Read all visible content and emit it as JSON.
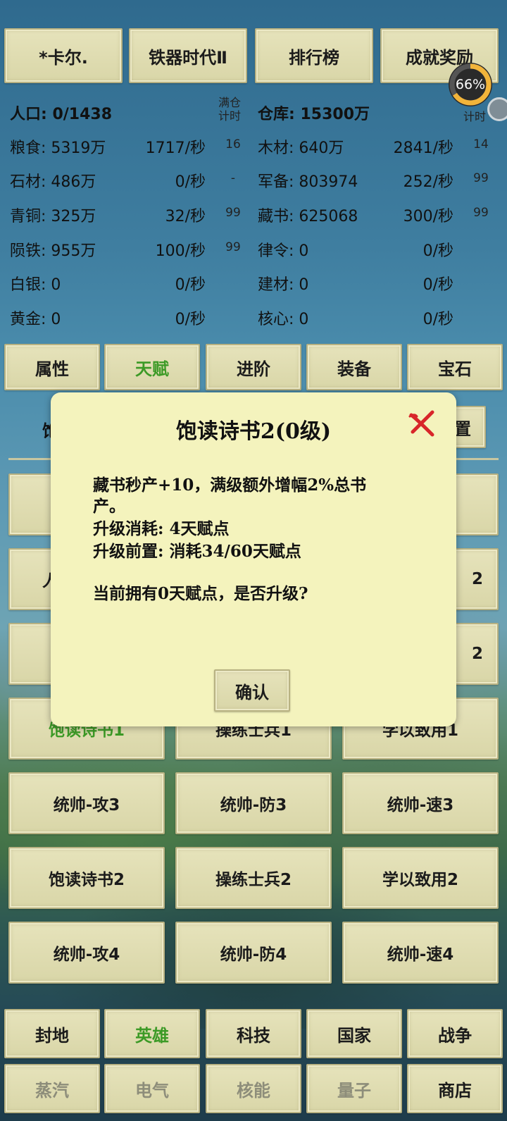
{
  "top_buttons": [
    {
      "label": "*卡尔."
    },
    {
      "label": "铁器时代Ⅱ"
    },
    {
      "label": "排行榜"
    },
    {
      "label": "成就奖励"
    }
  ],
  "progress": {
    "percent_text": "66%",
    "value": 0.66,
    "ring_color": "#f2b43a"
  },
  "header": {
    "population": "人口: 0/1438",
    "full_timer_label_1": "满仓",
    "full_timer_label_2": "计时",
    "warehouse": "仓库: 15300万",
    "right_timer_label": "计时"
  },
  "resources_left": [
    {
      "name": "粮食: 5319万",
      "rate": "1717/秒",
      "timer": "16"
    },
    {
      "name": "石材: 486万",
      "rate": "0/秒",
      "timer": "-"
    },
    {
      "name": "青铜: 325万",
      "rate": "32/秒",
      "timer": "99"
    },
    {
      "name": "陨铁: 955万",
      "rate": "100/秒",
      "timer": "99"
    },
    {
      "name": "白银: 0",
      "rate": "0/秒",
      "timer": ""
    },
    {
      "name": "黄金: 0",
      "rate": "0/秒",
      "timer": ""
    }
  ],
  "resources_right": [
    {
      "name": "木材: 640万",
      "rate": "2841/秒",
      "timer": "14"
    },
    {
      "name": "军备: 803974",
      "rate": "252/秒",
      "timer": "99"
    },
    {
      "name": "藏书: 625068",
      "rate": "300/秒",
      "timer": "99"
    },
    {
      "name": "律令: 0",
      "rate": "0/秒",
      "timer": ""
    },
    {
      "name": "建材: 0",
      "rate": "0/秒",
      "timer": ""
    },
    {
      "name": "核心: 0",
      "rate": "0/秒",
      "timer": ""
    }
  ],
  "hero_tabs": [
    {
      "label": "属性"
    },
    {
      "label": "天赋",
      "active": true
    },
    {
      "label": "进阶"
    },
    {
      "label": "装备"
    },
    {
      "label": "宝石"
    }
  ],
  "behind_dialog": {
    "left_fragment": "饱",
    "right_button_fragment": "置",
    "row2_left": "人",
    "row2_right": "2",
    "row3_right": "2"
  },
  "talents": [
    [
      "饱读诗书1",
      "操练士兵1",
      "学以致用1"
    ],
    [
      "统帅-攻3",
      "统帅-防3",
      "统帅-速3"
    ],
    [
      "饱读诗书2",
      "操练士兵2",
      "学以致用2"
    ],
    [
      "统帅-攻4",
      "统帅-防4",
      "统帅-速4"
    ]
  ],
  "dialog": {
    "title": "饱读诗书2(0级)",
    "line1": "藏书秒产+10，满级额外增幅2%总书",
    "line2": "产。",
    "line3": "升级消耗: 4天赋点",
    "line4": "升级前置: 消耗34/60天赋点",
    "line5": "当前拥有0天赋点，是否升级?",
    "confirm_label": "确认",
    "close_icon": "close-x-icon",
    "close_color": "#d8262a"
  },
  "bottom_nav_row1": [
    {
      "label": "封地"
    },
    {
      "label": "英雄",
      "active": true
    },
    {
      "label": "科技"
    },
    {
      "label": "国家"
    },
    {
      "label": "战争"
    }
  ],
  "bottom_nav_row2": [
    {
      "label": "蒸汽",
      "disabled": true
    },
    {
      "label": "电气",
      "disabled": true
    },
    {
      "label": "核能",
      "disabled": true
    },
    {
      "label": "量子",
      "disabled": true
    },
    {
      "label": "商店"
    }
  ]
}
